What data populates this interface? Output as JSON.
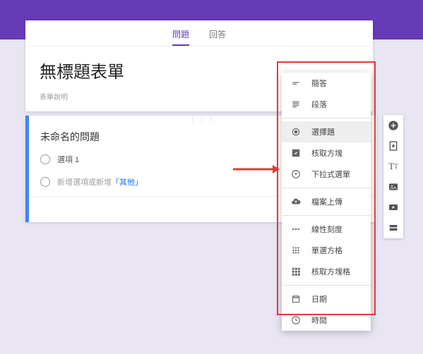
{
  "header": {
    "tabs": {
      "questions": "問題",
      "responses": "回答"
    }
  },
  "form": {
    "title": "無標題表單",
    "description": "表單說明"
  },
  "question": {
    "title": "未命名的問題",
    "option1": "選項 1",
    "add_option": "新增選項",
    "or": " 或 ",
    "add_other_prefix": "新增",
    "add_other_link": "「其他」"
  },
  "menu": {
    "short_answer": "簡答",
    "paragraph": "段落",
    "multiple_choice": "選擇題",
    "checkboxes": "核取方塊",
    "dropdown": "下拉式選單",
    "file_upload": "檔案上傳",
    "linear_scale": "線性刻度",
    "grid_radio": "單選方格",
    "grid_check": "核取方塊格",
    "date": "日期",
    "time": "時間"
  },
  "side": {
    "add": "add-question",
    "import": "import-questions",
    "text": "add-title",
    "image": "add-image",
    "video": "add-video",
    "section": "add-section"
  }
}
